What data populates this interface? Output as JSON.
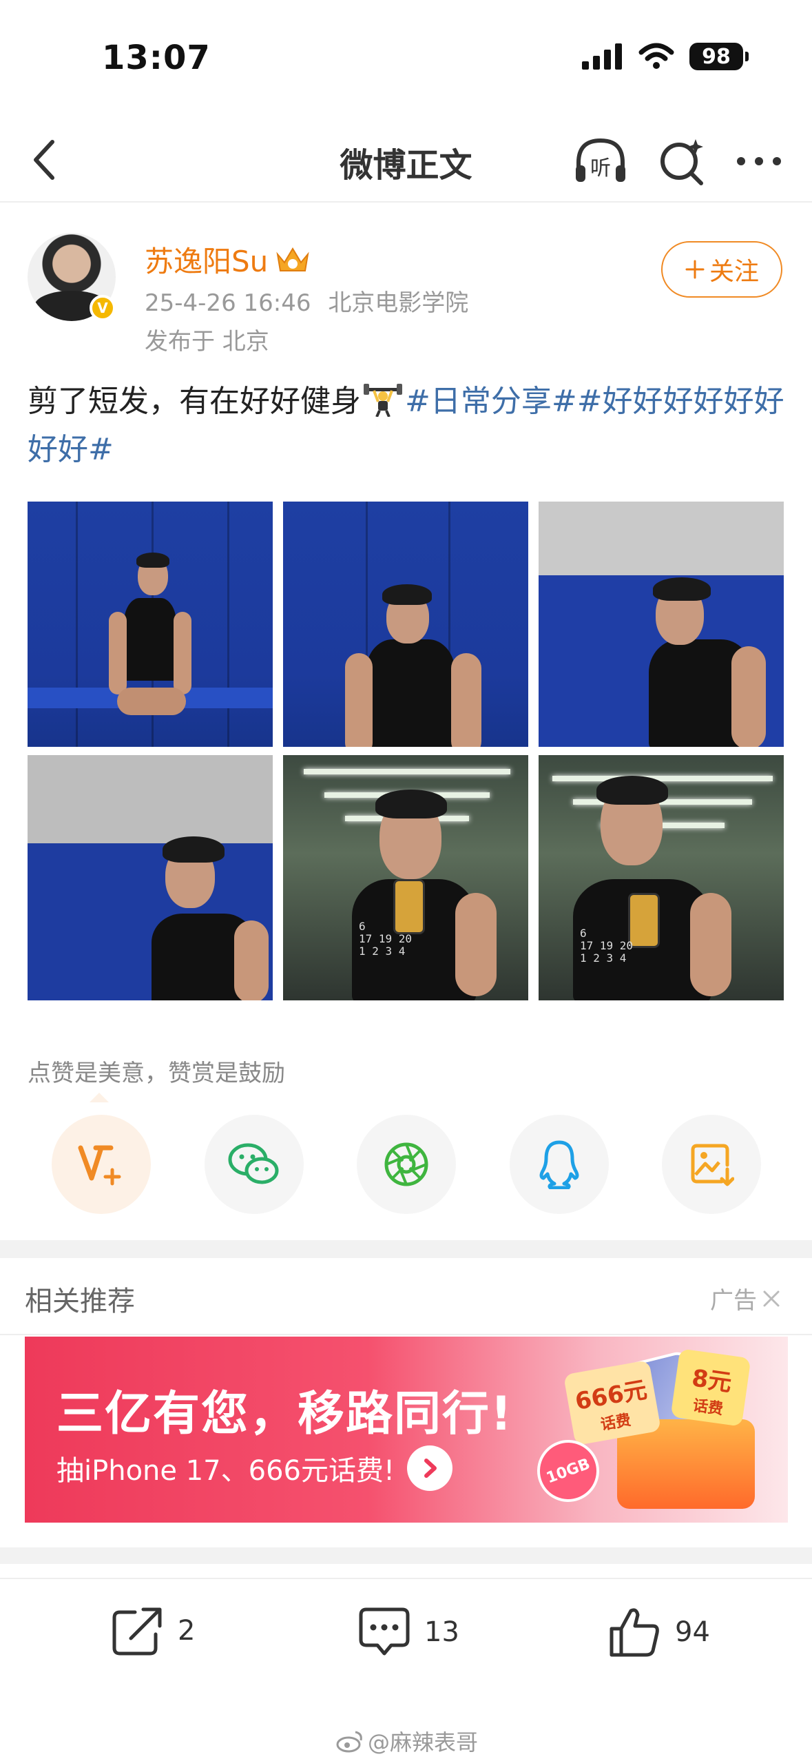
{
  "status_bar": {
    "time": "13:07",
    "battery": "98"
  },
  "nav": {
    "title": "微博正文",
    "listen_label": "听"
  },
  "post": {
    "username": "苏逸阳Su",
    "verified_badge": "V",
    "timestamp": "25-4-26 16:46",
    "source": "北京电影学院",
    "location": "发布于 北京",
    "follow_label": "关注",
    "text_before": "剪了短发，有在好好健身",
    "hashtag_1": "#日常分享#",
    "hashtag_2": "#好好好好好好好好#",
    "photos": [
      "photo-1",
      "photo-2",
      "photo-3",
      "photo-4",
      "photo-5",
      "photo-6"
    ]
  },
  "tip": {
    "text": "点赞是美意，赞赏是鼓励"
  },
  "share": [
    {
      "name": "vip-reward",
      "icon": "v-plus-icon"
    },
    {
      "name": "wechat",
      "icon": "wechat-icon"
    },
    {
      "name": "moments",
      "icon": "moments-icon"
    },
    {
      "name": "qq",
      "icon": "qq-icon"
    },
    {
      "name": "save-image",
      "icon": "save-image-icon"
    }
  ],
  "recommend": {
    "title": "相关推荐",
    "ad_label": "广告"
  },
  "banner": {
    "title": "三亿有您，移路同行!",
    "subtitle": "抽iPhone 17、666元话费!",
    "coupon_1_value": "666元",
    "coupon_1_label": "话费",
    "coupon_2_value": "8元",
    "coupon_2_label": "话费",
    "data_badge": "10GB"
  },
  "actions": {
    "reposts": "2",
    "comments": "13",
    "likes": "94"
  },
  "watermark": "@麻辣表哥",
  "colors": {
    "accent": "#ee7b11",
    "hashtag": "#3e6ea8",
    "banner_red": "#ee3a5a"
  }
}
